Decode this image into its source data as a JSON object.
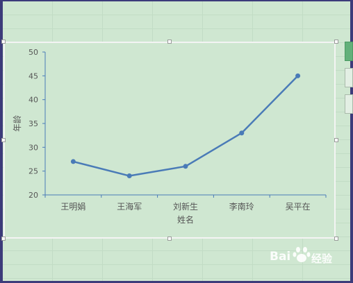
{
  "colors": {
    "background": "#cfe7d1",
    "line": "#4a7bb7",
    "axis": "#4a7bb7",
    "text": "#555555",
    "frame": "#3c3b7a"
  },
  "chart_data": {
    "type": "line",
    "categories": [
      "王明娟",
      "王海军",
      "刘新生",
      "李南玲",
      "吴平在"
    ],
    "series": [
      {
        "values": [
          27,
          24,
          26,
          33,
          45
        ]
      }
    ],
    "title": "",
    "xlabel": "姓名",
    "ylabel": "年龄",
    "ylim": [
      20,
      50
    ],
    "yticks": [
      20,
      25,
      30,
      35,
      40,
      45,
      50
    ],
    "grid": false,
    "legend": "none"
  },
  "side_buttons": [
    "chart-elements",
    "chart-styles",
    "chart-filters"
  ],
  "watermark": {
    "text": "Bai",
    "text2": "经验",
    "icon": "baidu-paw-icon"
  }
}
